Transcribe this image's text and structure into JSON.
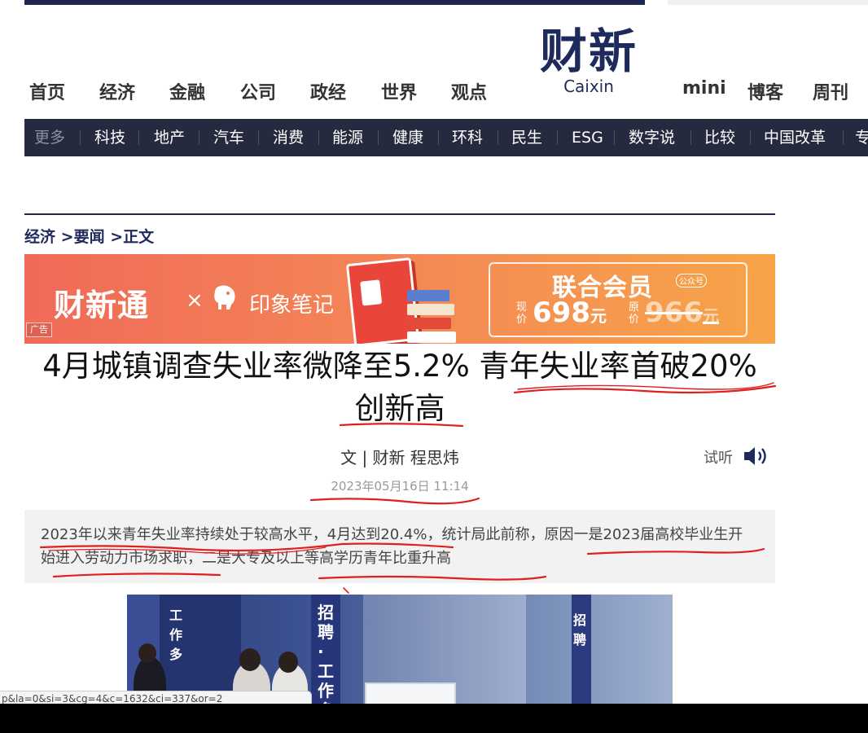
{
  "logo": {
    "cn": "财新",
    "en": "Caixin"
  },
  "main_nav": [
    "首页",
    "经济",
    "金融",
    "公司",
    "政经",
    "世界",
    "观点",
    "mini",
    "博客",
    "周刊"
  ],
  "sub_nav": [
    "更多",
    "科技",
    "地产",
    "汽车",
    "消费",
    "能源",
    "健康",
    "环科",
    "民生",
    "ESG",
    "数字说",
    "比较",
    "中国改革",
    "专"
  ],
  "breadcrumb": {
    "section": "经济",
    "sep1": " >",
    "subsection": "要闻",
    "sep2": " >",
    "current": "正文"
  },
  "ad": {
    "brand": "财新通",
    "times": "×",
    "partner": "印象笔记",
    "label": "广告",
    "member": "联合会员",
    "member_tag": "公众号",
    "now_label": "现价",
    "now_price": "698",
    "orig_label": "原价",
    "orig_price": "966",
    "currency": "元"
  },
  "article": {
    "title_line1": "4月城镇调查失业率微降至5.2% 青年失业率首破20%",
    "title_line2": "创新高",
    "byline": "文 | 财新 程思炜",
    "listen": "试听",
    "date": "2023年05月16日 11:14",
    "summary": "2023年以来青年失业率持续处于较高水平，4月达到20.4%，统计局此前称，原因一是2023届高校毕业生开始进入劳动力市场求职，二是大专及以上等高学历青年比重升高"
  },
  "photo": {
    "sign1": "工作多",
    "sign2": "招聘·工作多",
    "sign3": "招聘"
  },
  "status_url": "p&la=0&si=3&cg=4&c=1632&ci=337&or=2",
  "colors": {
    "brand_navy": "#1f2a5c",
    "subnav_bg": "#252a3e",
    "annotation_red": "#e02020"
  }
}
